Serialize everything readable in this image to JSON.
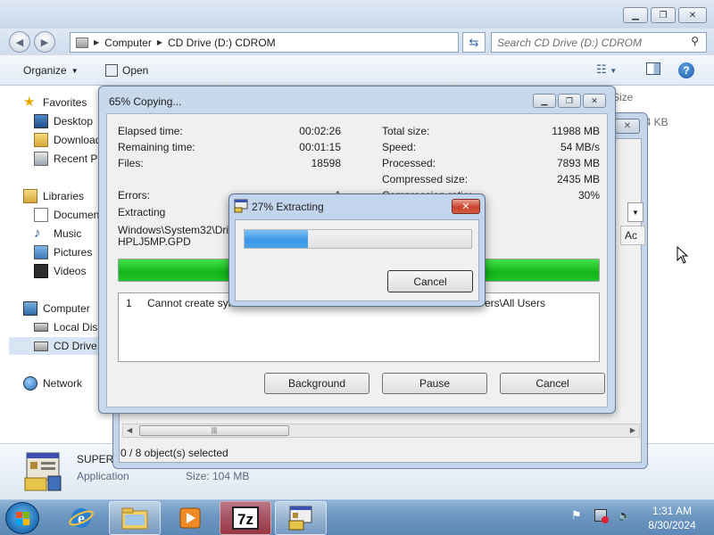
{
  "explorer": {
    "address": {
      "crumb1": "Computer",
      "crumb2": "CD Drive (D:) CDROM"
    },
    "search_placeholder": "Search CD Drive (D:) CDROM",
    "toolbar": {
      "organize": "Organize",
      "open": "Open"
    },
    "column_size": "Size",
    "size_value": "54 KB",
    "nav": {
      "favorites": "Favorites",
      "desktop": "Desktop",
      "downloads": "Downloads",
      "recent": "Recent Places",
      "libraries": "Libraries",
      "documents": "Documents",
      "music": "Music",
      "pictures": "Pictures",
      "videos": "Videos",
      "computer": "Computer",
      "local_disk": "Local Disk (C:)",
      "cd_drive": "CD Drive (D:) CDROM",
      "network": "Network"
    },
    "details": {
      "name": "SUPER",
      "type": "Application",
      "size": "Size: 104 MB"
    }
  },
  "zip_window": {
    "col_ac": "Ac",
    "status": "0 / 8 object(s) selected"
  },
  "copy_dialog": {
    "title": "65% Copying...",
    "elapsed_label": "Elapsed time:",
    "elapsed_value": "00:02:26",
    "remaining_label": "Remaining time:",
    "remaining_value": "00:01:15",
    "files_label": "Files:",
    "files_value": "18598",
    "total_label": "Total size:",
    "total_value": "11988 MB",
    "speed_label": "Speed:",
    "speed_value": "54 MB/s",
    "processed_label": "Processed:",
    "processed_value": "7893 MB",
    "compressed_label": "Compressed size:",
    "compressed_value": "2435 MB",
    "ratio_label": "Compression ratio:",
    "ratio_value": "30%",
    "errors_label": "Errors:",
    "errors_value": "1",
    "extracting_label": "Extracting",
    "path_line1": "Windows\\System32\\Driver",
    "path_line2": "HPLJ5MP.GPD",
    "progress": 1.0,
    "log_num": "1",
    "log_msg": "Cannot create symb",
    "log_msg_tail": "ers\\All Users",
    "btn_background": "Background",
    "btn_pause": "Pause",
    "btn_cancel": "Cancel"
  },
  "extract_dialog": {
    "title": "27% Extracting",
    "progress": 0.28,
    "cancel": "Cancel"
  },
  "taskbar": {
    "time": "1:31 AM",
    "date": "8/30/2024"
  }
}
